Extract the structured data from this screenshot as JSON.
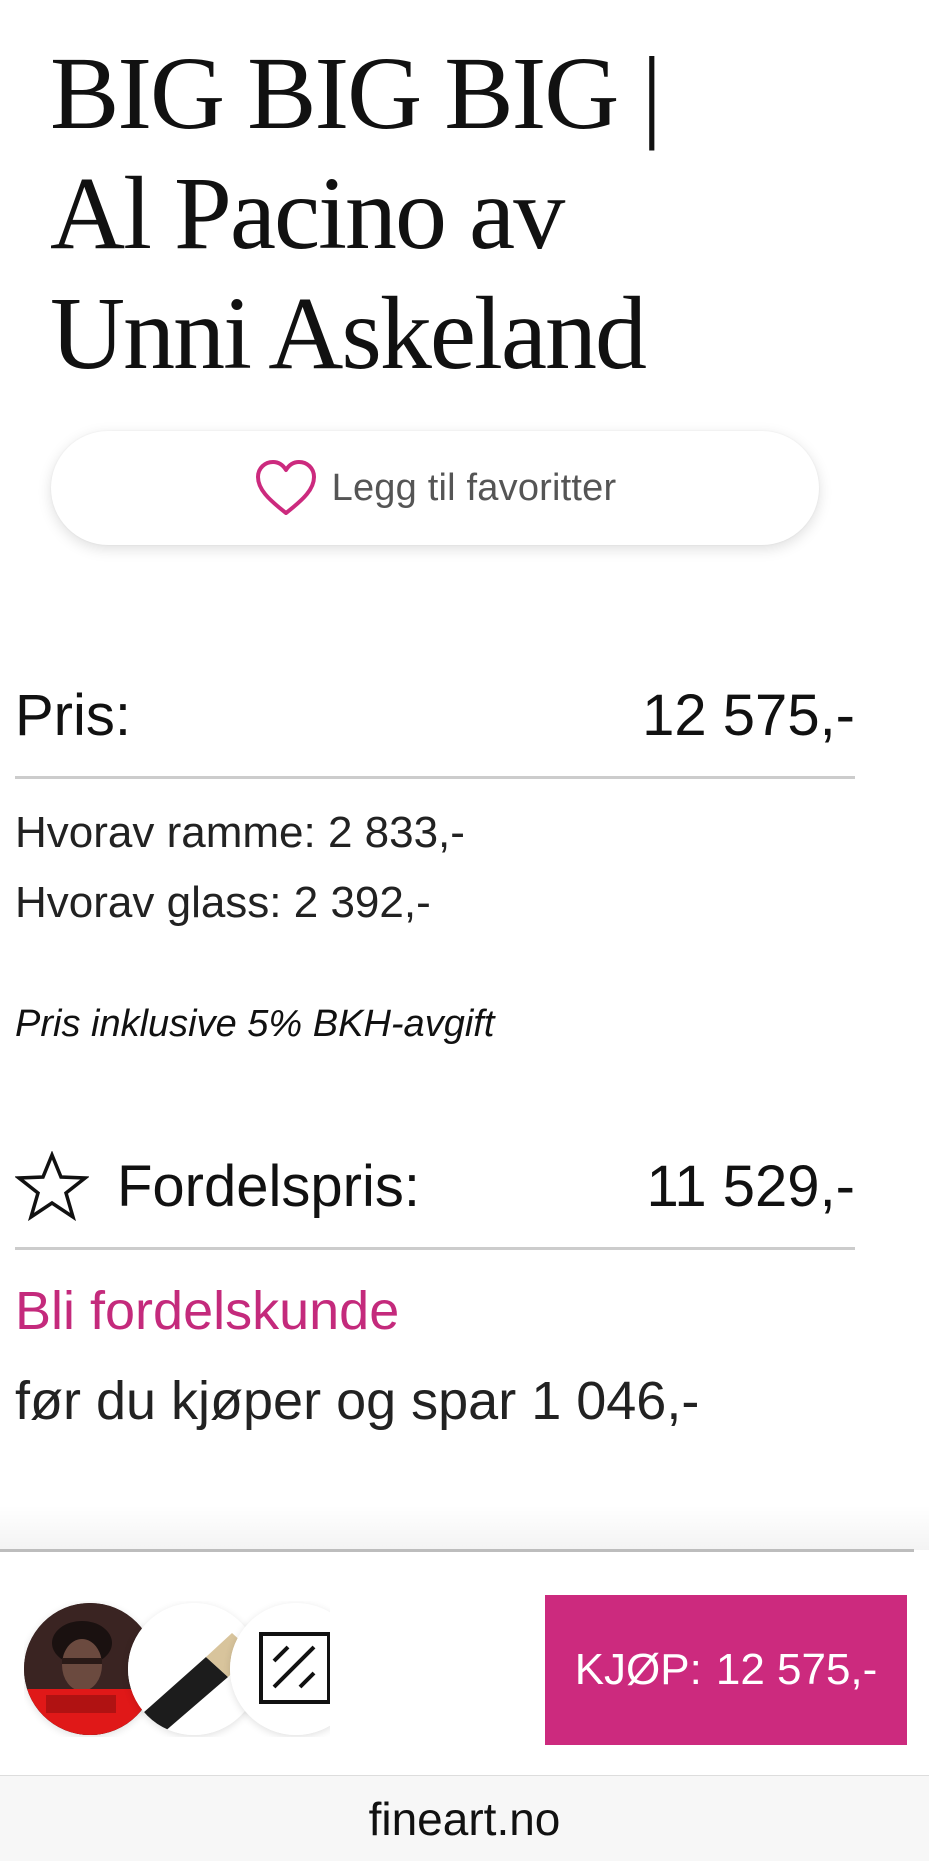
{
  "product": {
    "title": "BIG BIG BIG | Al Pacino av Unni Askeland"
  },
  "favorite": {
    "label": "Legg til favoritter",
    "icon": "heart-icon"
  },
  "price": {
    "label": "Pris:",
    "value": "12 575,-",
    "frame": "Hvorav ramme: 2 833,-",
    "glass": "Hvorav glass: 2 392,-",
    "note": "Pris inklusive 5% BKH-avgift"
  },
  "advantage": {
    "icon": "star-icon",
    "label": "Fordelspris:",
    "value": "11 529,-",
    "join_link": "Bli fordelskunde",
    "savings_text": "før du kjøper og spar 1 046,-"
  },
  "purchase": {
    "button_label": "KJØP:",
    "button_price": "12 575,-"
  },
  "browser": {
    "url": "fineart.no"
  },
  "colors": {
    "accent": "#cc2a7e",
    "link": "#c42a7c"
  }
}
